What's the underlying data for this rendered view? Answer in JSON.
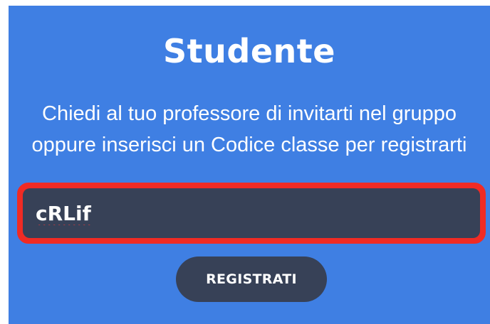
{
  "card": {
    "title": "Studente",
    "description": [
      "Chiedi al tuo professore di invitarti nel gruppo",
      "oppure inserisci un Codice classe per registrarti"
    ],
    "code_field": {
      "value": "cRLif",
      "highlight_color": "#f02b24"
    },
    "register_label": "REGISTRATI"
  },
  "colors": {
    "background": "#3f7fe3",
    "field": "#374157",
    "button": "#374157"
  }
}
